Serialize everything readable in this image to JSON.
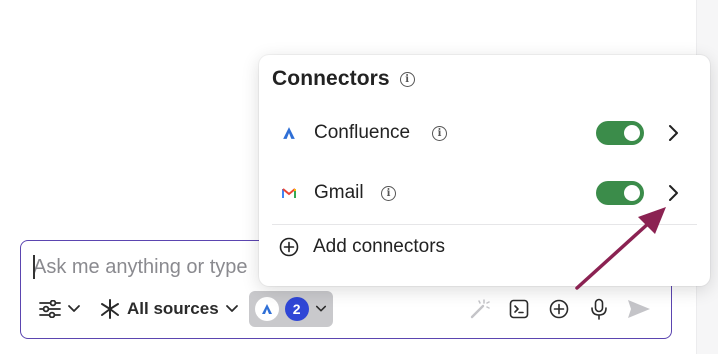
{
  "composer": {
    "placeholder": "Ask me anything or type"
  },
  "toolbar": {
    "sources_label": "All sources",
    "connector_count": "2"
  },
  "popover": {
    "title": "Connectors",
    "connectors": [
      {
        "label": "Confluence",
        "enabled": true,
        "logo": "confluence-logo"
      },
      {
        "label": "Gmail",
        "enabled": true,
        "logo": "gmail-logo"
      }
    ],
    "add_label": "Add connectors"
  },
  "colors": {
    "accent_border": "#5b45b0",
    "toggle_on": "#3b8c4a",
    "count_badge": "#2f46d6",
    "annotation_arrow": "#8b2252"
  }
}
